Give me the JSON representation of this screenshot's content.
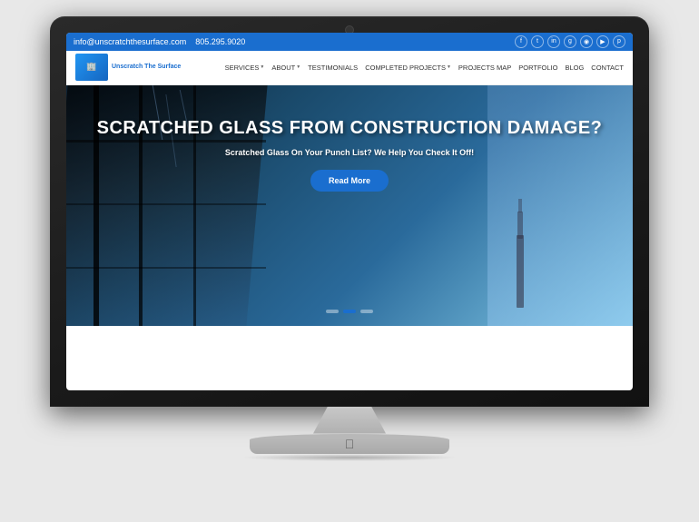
{
  "topBar": {
    "email": "info@unscratchthesurface.com",
    "phone": "805.295.9020",
    "socialIcons": [
      "f",
      "t",
      "in",
      "g+",
      "📷",
      "▶",
      "p"
    ]
  },
  "nav": {
    "logoLine1": "Unscratch",
    "logoLine2": "The Surface",
    "logoSubtext": "Unscratch The Surface",
    "links": [
      {
        "label": "SERVICES",
        "hasDropdown": true
      },
      {
        "label": "ABOUT",
        "hasDropdown": true
      },
      {
        "label": "TESTIMONIALS",
        "hasDropdown": false
      },
      {
        "label": "COMPLETED PROJECTS",
        "hasDropdown": true
      },
      {
        "label": "PROJECTS MAP",
        "hasDropdown": false
      },
      {
        "label": "PORTFOLIO",
        "hasDropdown": false
      },
      {
        "label": "BLOG",
        "hasDropdown": false
      },
      {
        "label": "CONTACT",
        "hasDropdown": false
      }
    ]
  },
  "hero": {
    "title": "SCRATCHED GLASS FROM CONSTRUCTION DAMAGE?",
    "subtitle": "Scratched Glass On Your Punch List? We Help You Check It Off!",
    "buttonLabel": "Read More",
    "dots": [
      false,
      true,
      false
    ]
  },
  "colors": {
    "brandBlue": "#1a6ecf",
    "darkBg": "#1a1a1a",
    "heroBg": "#1a3a5c"
  }
}
